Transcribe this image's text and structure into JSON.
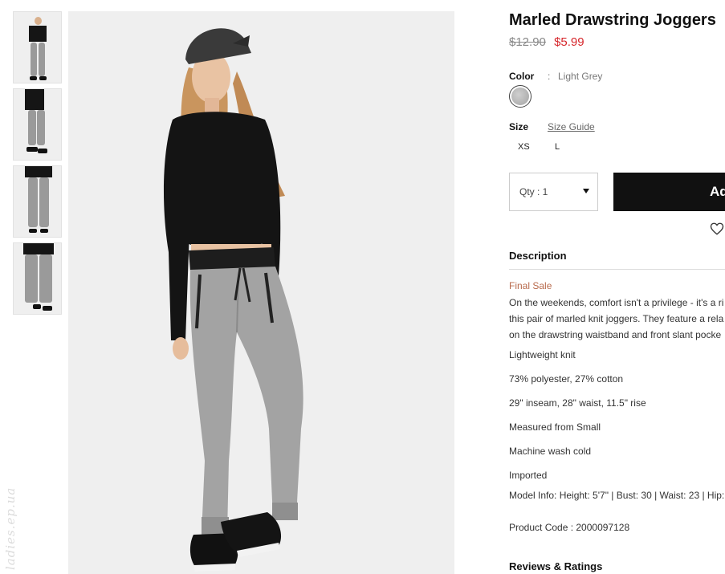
{
  "thumbnails": [
    {
      "label": "thumb-front-full"
    },
    {
      "label": "thumb-side"
    },
    {
      "label": "thumb-back"
    },
    {
      "label": "thumb-detail"
    }
  ],
  "watermark": "ladies.ep.ua",
  "product": {
    "title": "Marled Drawstring Joggers",
    "price_original": "$12.90",
    "price_sale": "$5.99",
    "color_label": "Color",
    "color_separator": ":",
    "color_value": "Light Grey",
    "size_label": "Size",
    "size_guide": "Size Guide",
    "sizes": [
      "XS",
      "L"
    ],
    "qty_text": "Qty : 1",
    "add_button": "Ad",
    "description_heading": "Description",
    "final_sale": "Final Sale",
    "description_lines": [
      "On the weekends, comfort isn't a privilege - it's a ri",
      "this pair of marled knit joggers. They feature a rela",
      "on the drawstring waistband and front slant pocke"
    ],
    "details": [
      "Lightweight knit",
      "73% polyester, 27% cotton",
      "29\" inseam, 28\" waist, 11.5\" rise",
      "Measured from Small",
      "Machine wash cold",
      "Imported",
      "Model Info: Height: 5'7\" | Bust: 30 | Waist: 23 | Hip:"
    ],
    "product_code": "Product Code : 2000097128",
    "reviews_heading": "Reviews & Ratings"
  },
  "colors": {
    "sale": "#d6262b",
    "final_sale": "#b86a4c",
    "button_bg": "#111111"
  },
  "icons": {
    "qty_caret": "caret-down-icon",
    "wishlist": "heart-icon"
  }
}
